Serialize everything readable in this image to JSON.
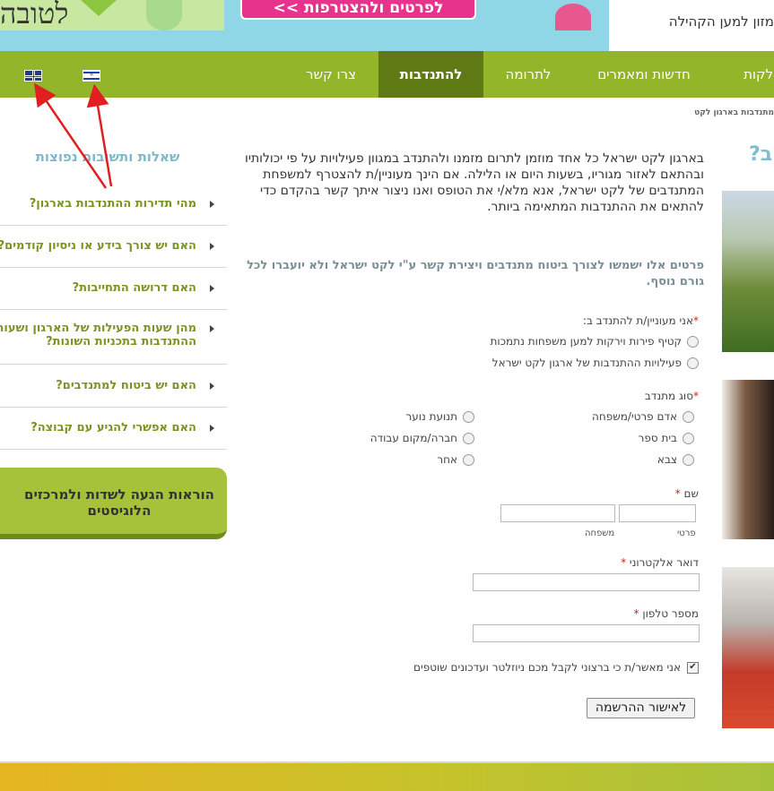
{
  "banner": {
    "left_text": "לטובה",
    "cta_label": "לפרטים ולהצטרפות >>",
    "right_text": "מזון למען הקהילה"
  },
  "nav": {
    "items": [
      {
        "label": "צרו קשר",
        "active": false
      },
      {
        "label": "להתנדבות",
        "active": true
      },
      {
        "label": "לתרומה",
        "active": false
      },
      {
        "label": "חדשות ומאמרים",
        "active": false
      },
      {
        "label": "חלקות",
        "active": false
      }
    ],
    "languages": [
      {
        "icon": "israel-flag-icon"
      },
      {
        "icon": "uk-flag-icon"
      }
    ]
  },
  "breadcrumb": "מתנדבות בארגון לקט",
  "sidebar": {
    "faq_title": "שאלות ותשובות נפוצות",
    "faq_items": [
      "מהי תדירות ההתנדבות בארגון?",
      "האם יש צורך בידע או ניסיון קודמים?",
      "האם דרושה התחייבות?",
      "מהן שעות הפעילות של הארגון ושעות ההתנדבות בתכניות השונות?",
      "האם יש ביטוח למתנדבים?",
      "האם אפשרי להגיע עם קבוצה?"
    ],
    "logistics_label": "הוראות הגעה לשדות ולמרכזים הלוגיסטים"
  },
  "main": {
    "right_title": "?ב",
    "intro": "בארגון לקט ישראל כל אחד מוזמן לתרום מזמנו ולהתנדב במגוון פעילויות על פי יכולותיו ובהתאם לאזור מגוריו, בשעות היום או הלילה. אם הינך מעוניין/ת להצטרף למשפחת המתנדבים של לקט ישראל, אנא מלא/י את הטופס ואנו ניצור איתך קשר בהקדם כדי להתאים את ההתנדבות המתאימה ביותר.",
    "privacy": "פרטים אלו ישמשו לצורך ביטוח מתנדבים ויצירת קשר ע\"י לקט ישראל ולא יועברו לכל גורם נוסף.",
    "form": {
      "interest_label": "אני מעוניין/ת להתנדב ב:",
      "interest_options": [
        "קטיף פירות וירקות למען משפחות נתמכות",
        "פעילויות ההתנדבות של ארגון לקט ישראל"
      ],
      "type_label": "סוג מתנדב",
      "type_options": [
        "אדם פרטי/משפחה",
        "תנועת נוער",
        "בית ספר",
        "חברה/מקום עבודה",
        "צבא",
        "אחר"
      ],
      "name_label": "שם",
      "first_name_sub": "פרטי",
      "last_name_sub": "משפחה",
      "email_label": "דואר אלקטרוני",
      "phone_label": "מספר טלפון",
      "required_mark": "*",
      "consent_label": "אני מאשר/ת כי ברצוני לקבל מכם ניוזלטר ועדכונים שוטפים",
      "consent_checked": true,
      "consent_mark": "✔",
      "submit_label": "לאישור ההרשמה"
    }
  },
  "colors": {
    "nav_green": "#92b52a",
    "nav_active": "#5f7a15",
    "banner_blue": "#8fd6e6",
    "pink": "#e8338c",
    "faq_green": "#7a9422",
    "annotation_red": "#e02020"
  }
}
